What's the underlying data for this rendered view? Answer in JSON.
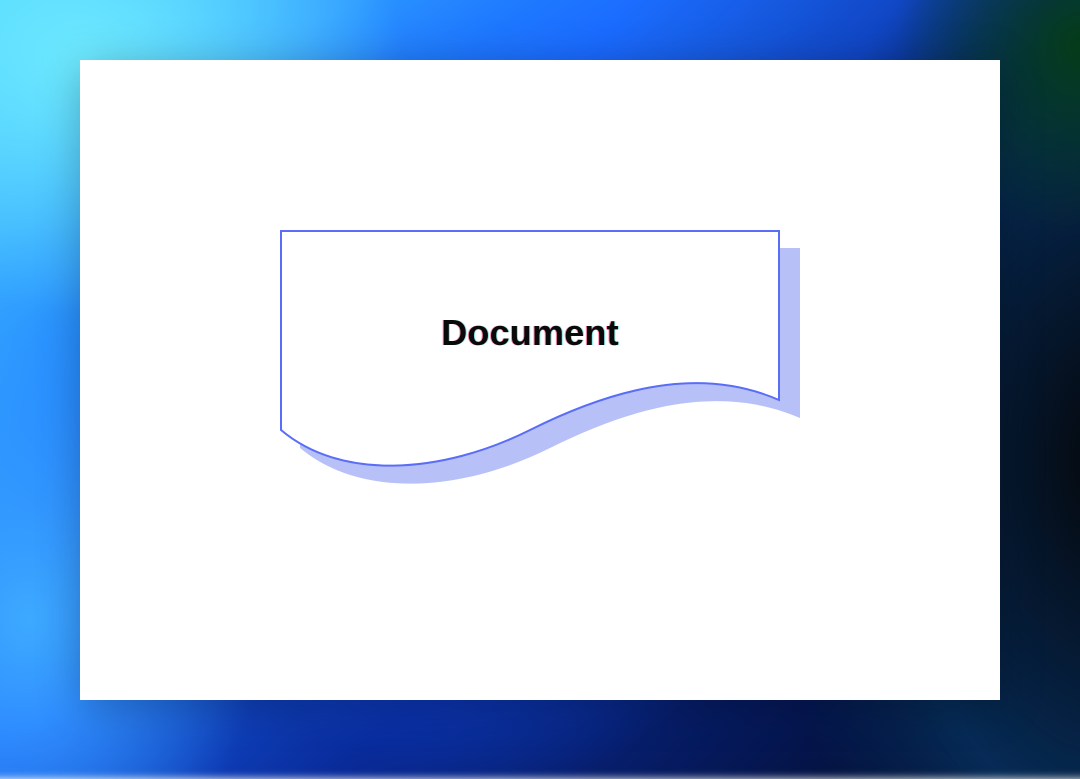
{
  "shape": {
    "type": "document",
    "label": "Document",
    "stroke_color": "#5a6df7",
    "fill_color": "#ffffff",
    "shadow_color": "#b8c1f7"
  }
}
